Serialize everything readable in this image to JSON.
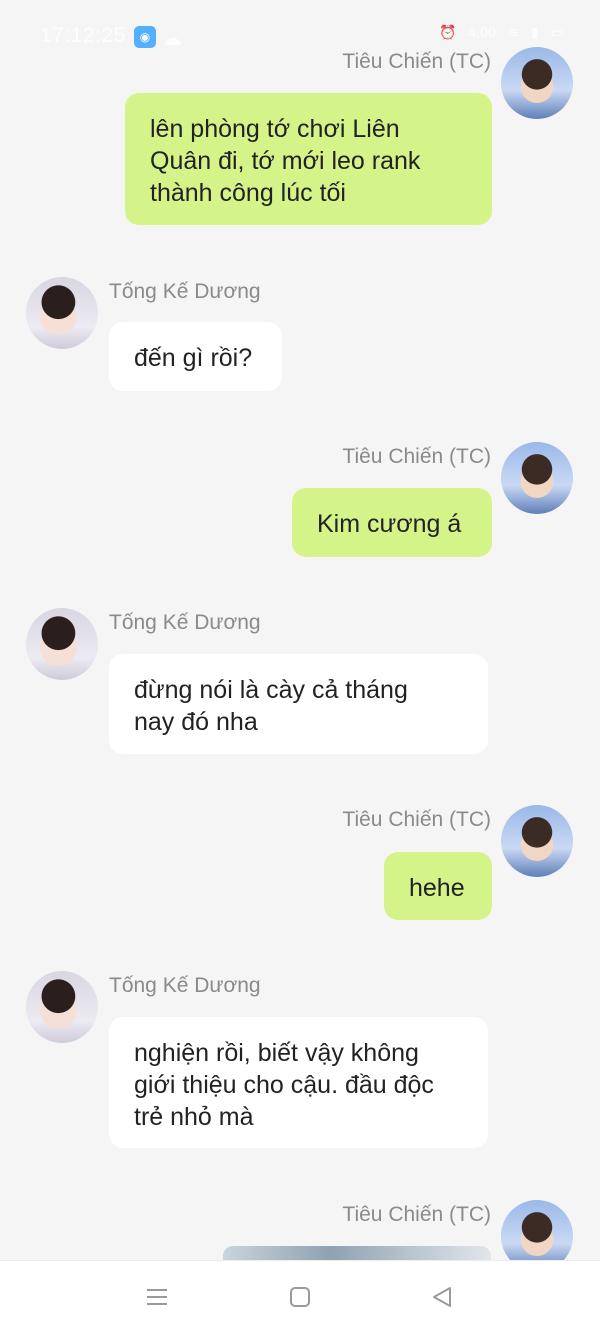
{
  "status_bar": {
    "time": "17:12:25",
    "icons": [
      "app-notification-icon",
      "cloud-icon",
      "alarm-icon",
      "wifi-icon",
      "signal-icon",
      "battery-icon"
    ],
    "speed": "4,00"
  },
  "contacts": {
    "me": "Tiêu Chiến (TC)",
    "friend": "Tống Kế Dương"
  },
  "messages": [
    {
      "sender": "Tiêu Chiến (TC)",
      "lines": [
        "lên phòng tớ chơi Liên",
        "Quân đi, tớ mới leo rank",
        "thành công lúc tối"
      ]
    },
    {
      "sender": "Tống Kế Dương",
      "lines": [
        "đến gì rồi?"
      ]
    },
    {
      "sender": "Tiêu Chiến (TC)",
      "lines": [
        "Kim cương á"
      ]
    },
    {
      "sender": "Tống Kế Dương",
      "lines": [
        "đừng nói là cày cả tháng",
        "nay đó nha"
      ]
    },
    {
      "sender": "Tiêu Chiến (TC)",
      "lines": [
        "hehe"
      ]
    },
    {
      "sender": "Tống Kế Dương",
      "lines": [
        "nghiện rồi, biết vậy không",
        "giới thiệu cho cậu. đầu độc",
        "trẻ nhỏ mà"
      ]
    },
    {
      "sender": "Tiêu Chiến (TC)",
      "lines": []
    }
  ],
  "nav_bar": {
    "buttons": [
      "menu-icon",
      "home-icon",
      "back-icon"
    ]
  },
  "colors": {
    "outgoing_bubble": "#d4f48a",
    "incoming_bubble": "#ffffff",
    "background": "#f5f5f5"
  }
}
